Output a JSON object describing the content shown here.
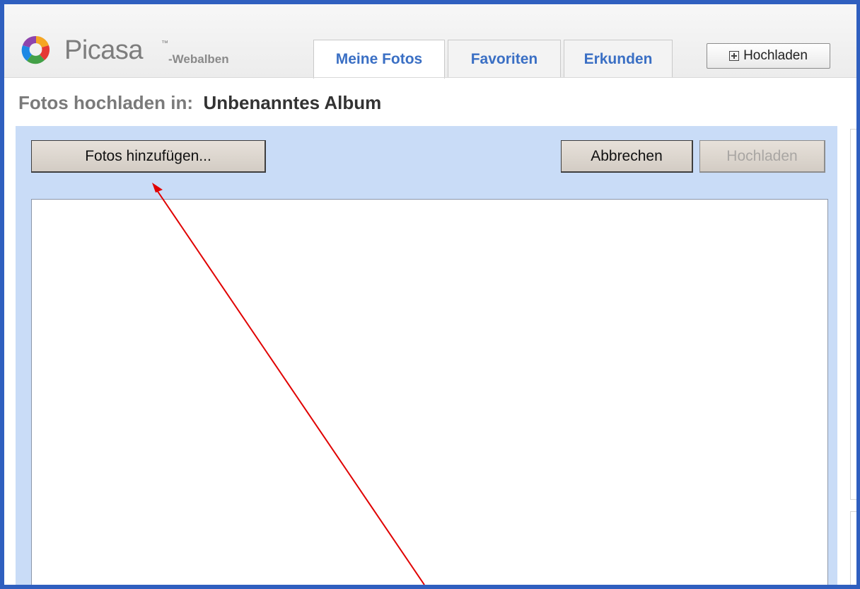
{
  "app": {
    "logo_text": "Picasa",
    "logo_tm": "™",
    "logo_suffix": "-Webalben"
  },
  "nav": {
    "tabs": [
      {
        "label": "Meine Fotos",
        "active": true
      },
      {
        "label": "Favoriten",
        "active": false
      },
      {
        "label": "Erkunden",
        "active": false
      }
    ],
    "upload_button": {
      "label": "Hochladen",
      "icon": "plus-box-icon"
    }
  },
  "page": {
    "title_prefix": "Fotos hochladen in:",
    "album_name": "Unbenanntes Album"
  },
  "upload_panel": {
    "add_photos_label": "Fotos hinzufügen...",
    "cancel_label": "Abbrechen",
    "upload_label": "Hochladen",
    "upload_enabled": false
  },
  "annotation": {
    "arrow_color": "#e00000",
    "points_to": "add-photos-button"
  },
  "colors": {
    "frame": "#2f5fbf",
    "panel": "#c9dcf7",
    "tab_text": "#3a6fc4"
  }
}
